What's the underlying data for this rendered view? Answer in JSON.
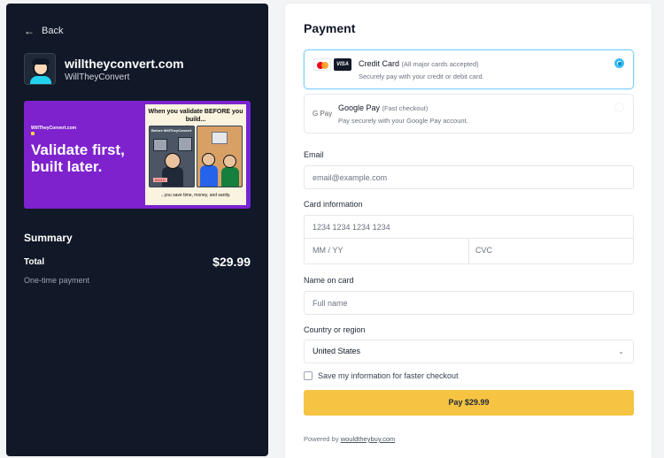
{
  "back": {
    "label": "Back",
    "icon": "arrow-left-icon"
  },
  "brand": {
    "title": "willtheyconvert.com",
    "subtitle": "WillTheyConvert"
  },
  "banner": {
    "domain": "WillTheyConvert.com",
    "headline": "Validate first, built later.",
    "comic_title": "When you validate BEFORE you build...",
    "panel1_title": "Before WillTheyConvert",
    "panel1_tag": "BUILD",
    "footer": "...you save time, money, and sanity."
  },
  "summary": {
    "title": "Summary",
    "total_label": "Total",
    "total_value": "$29.99",
    "note": "One-time payment"
  },
  "payment": {
    "title": "Payment",
    "methods": [
      {
        "title": "Credit Card",
        "hint": "(All major cards accepted)",
        "desc": "Securely pay with your credit or debit card.",
        "selected": true
      },
      {
        "title": "Google Pay",
        "hint": "(Fast checkout)",
        "desc": "Pay securely with your Google Pay account.",
        "selected": false,
        "logo": "G Pay"
      }
    ],
    "card_brands": {
      "visa": "VISA"
    }
  },
  "form": {
    "email_label": "Email",
    "email_placeholder": "email@example.com",
    "card_label": "Card information",
    "card_placeholder": "1234 1234 1234 1234",
    "exp_placeholder": "MM / YY",
    "cvc_placeholder": "CVC",
    "name_label": "Name on card",
    "name_placeholder": "Full name",
    "country_label": "Country or region",
    "country_value": "United States",
    "save_label": "Save my information for faster checkout",
    "pay_button": "Pay $29.99"
  },
  "footer": {
    "powered_prefix": "Powered by",
    "powered_link": "wouldtheybuy.com"
  },
  "colors": {
    "left_bg": "#111827",
    "accent": "#38bdf8",
    "pay": "#f6c343",
    "banner": "#7e22ce"
  }
}
